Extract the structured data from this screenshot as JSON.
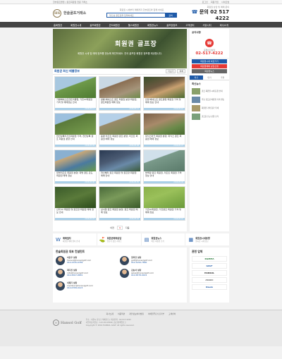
{
  "topbar": {
    "left": "한솔골프클럽 | 골프회원권 전문 거래소",
    "links": [
      "로그인",
      "회원가입",
      "사이트맵"
    ]
  },
  "header": {
    "logo_text": "한솔골프거래소",
    "logo_mark": "HS",
    "search_desc": "회원권 시세부터 매매까지 한솔골프와 함께 하세요",
    "search_placeholder": "찾으실 골프장을 입력하세요",
    "search_button": "검색",
    "phone_small": "회원권 상담 및 매매 문의",
    "phone_label": "문의",
    "phone_number": "02 517 4222"
  },
  "nav": [
    "홈회원권",
    "회원권시세",
    "골프회원권",
    "콘도회원권",
    "헬스회원권",
    "회원권뉴스",
    "골프장정보",
    "고객센터",
    "커뮤니티",
    "회사소개"
  ],
  "banner": {
    "title": "회원권 골프장",
    "desc": "회원권 시세 및 매매 정보를 한눈에 확인하세요. 전국 골프장 회원권 정보를 제공합니다."
  },
  "section": {
    "title": "회원권 최신 매물정보",
    "btn_more": "더보기",
    "btn_list": "목록"
  },
  "cards": [
    {
      "caption": "가평베네스트컨트리클럽, 기흥cc회원권 가격 및 매매정보 안내",
      "date": "2016.05.12"
    },
    {
      "caption": "광릉 베네스트 골프 회원권 분양 회원권, 골프회원권 매매 정보",
      "date": "2016.05.11"
    },
    {
      "caption": "안양 베네스트 골프클럽 회원권 가격 및 매매 정보 안내",
      "date": "2016.05.10"
    },
    {
      "caption": "천안상록리조트회원권 가격, 천안상록 골프 회원권 분양 안내",
      "date": "2016.05.09"
    },
    {
      "caption": "용평 리조트 회원권 골프 분양, 리조트 회원권 매매 정보",
      "date": "2016.05.08"
    },
    {
      "caption": "휘닉스파크 회원권 분양, 휘닉스 골프 회원권 매매 정보",
      "date": "2016.05.07"
    },
    {
      "caption": "대명리조트 회원권 분양, 대명 골프 콘도 회원권 매매 정보",
      "date": "2016.05.06"
    },
    {
      "caption": "파인밸리 골프 회원권 및 골프장 회원권 매매 안내",
      "date": "2016.05.05"
    },
    {
      "caption": "블루원 골프 회원권, 리조트 회원권 가격 정보 안내",
      "date": "2016.05.04"
    },
    {
      "caption": "신라 cc 회원권 및 골프장 회원권 매매 정보 안내",
      "date": "2016.05.03"
    },
    {
      "caption": "남서울 골프 회원권 분양, 골프 회원권 매매 정보",
      "date": "2016.05.02"
    },
    {
      "caption": "기흥cc회원권, 기흥골프 회원권 가격 및 매매 정보",
      "date": "2016.05.01"
    }
  ],
  "pager": {
    "prev": "이전",
    "current": "1",
    "next": "다음"
  },
  "services": [
    {
      "title": "매매절차",
      "sub": "회원권 매매 절차 안내",
      "icon": "W"
    },
    {
      "title": "회원권매매상담",
      "sub": "전문가 상담 서비스",
      "icon": "⛳"
    },
    {
      "title": "회원권뉴스",
      "sub": "최신 회원권 소식",
      "icon": "▤"
    },
    {
      "title": "회원권시세동향",
      "sub": "실시간 시세 정보",
      "icon": "▦"
    }
  ],
  "consult": {
    "title": "한솔회원권 대표 컨설턴트",
    "people": [
      {
        "name": "이윤우 실장",
        "email": "hansol@hansolgolf.com",
        "phone": "010-2345-6789"
      },
      {
        "name": "엄미연 실장",
        "email": "golf@hansolgolf.com",
        "phone": "010-3456-7890"
      },
      {
        "name": "최다진 실장",
        "email": "info@hansolgolf.com",
        "phone": "010-4567-8901"
      },
      {
        "name": "김효서 실장",
        "email": "sales@hansolgolf.com",
        "phone": "010-5678-9012"
      },
      {
        "name": "이재기 실장",
        "email": "member@hansolgolf.com",
        "phone": "010-6789-0123"
      }
    ]
  },
  "partners": {
    "title": "관련 업체",
    "logos": [
      "KGMMA",
      "GOLF",
      "HANSOL",
      "ASSOC",
      "Daum"
    ]
  },
  "side": {
    "title": "공지사항",
    "phone_label": "홈페이지상담",
    "phone_number": "02-517-4222",
    "btn1": "회원권시세 바로가기",
    "btn2": "회원권매매 상담신청",
    "btn3": "회원권뉴스",
    "tabs": [
      "최신",
      "인기",
      "추천"
    ],
    "news_label": "최신뉴스",
    "news": [
      "골프 회원권 시세 동향 안내",
      "주요 골프장 회원권 가격 변동",
      "회원권 거래 증가 추세",
      "골프장 신규 분양 소식"
    ]
  },
  "footer": {
    "links": [
      "회사소개",
      "이용약관",
      "개인정보처리방침",
      "이메일무단수집거부",
      "고객센터"
    ],
    "logo": "Hansol Golf",
    "logo_mark": "H",
    "info1": "주소 : 서울시 강남구 테헤란로 | 대표전화 : 02-517-4222",
    "info2": "사업자등록번호 : 123-45-67890 | 통신판매업신고",
    "info3": "Copyright © 2016 HANSOL GOLF. All rights reserved."
  },
  "colors": {
    "brand_blue": "#1e5aa8",
    "accent_red": "#e53935",
    "nav_dark": "#444444"
  }
}
